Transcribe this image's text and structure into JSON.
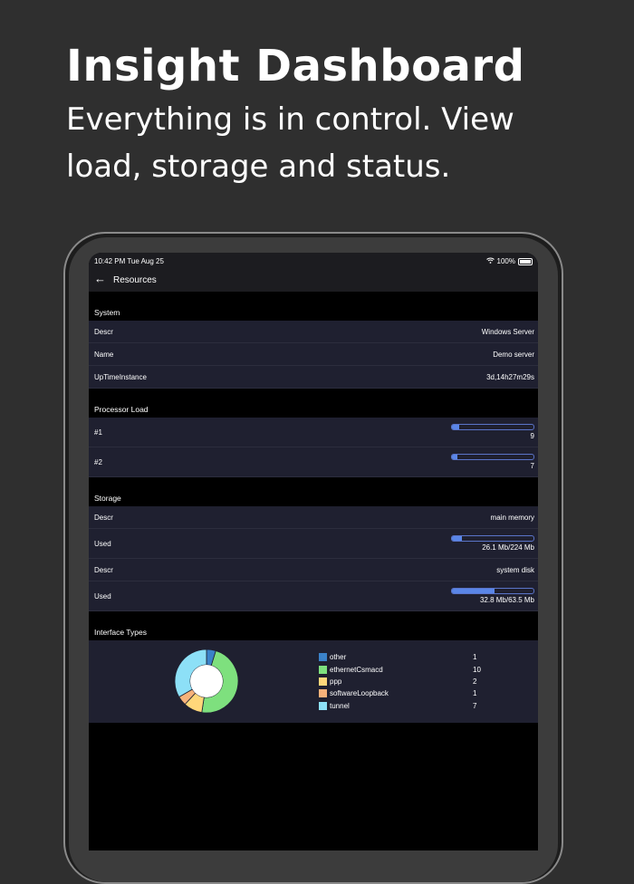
{
  "hero": {
    "title": "Insight Dashboard",
    "subtitle": "Everything is in control. View load, storage and status."
  },
  "status_bar": {
    "time": "10:42 PM   Tue Aug 25",
    "battery": "100%"
  },
  "nav": {
    "title": "Resources"
  },
  "system": {
    "header": "System",
    "rows": [
      {
        "label": "Descr",
        "value": "Windows Server"
      },
      {
        "label": "Name",
        "value": "Demo server"
      },
      {
        "label": "UpTimeInstance",
        "value": "3d,14h27m29s"
      }
    ]
  },
  "processor": {
    "header": "Processor Load",
    "rows": [
      {
        "label": "#1",
        "value": "9",
        "level": 0.09
      },
      {
        "label": "#2",
        "value": "7",
        "level": 0.07
      }
    ]
  },
  "storage": {
    "header": "Storage",
    "descr1": {
      "label": "Descr",
      "value": "main memory"
    },
    "used1": {
      "label": "Used",
      "value": "26.1 Mb/224 Mb",
      "level": 0.117
    },
    "descr2": {
      "label": "Descr",
      "value": "system disk"
    },
    "used2": {
      "label": "Used",
      "value": "32.8 Mb/63.5 Mb",
      "level": 0.517
    }
  },
  "interfaces": {
    "header": "Interface Types",
    "chart_data": {
      "type": "pie",
      "categories": [
        "other",
        "ethernetCsmacd",
        "ppp",
        "softwareLoopback",
        "tunnel"
      ],
      "values": [
        1,
        10,
        2,
        1,
        7
      ],
      "colors": [
        "#3b82c8",
        "#7ee07e",
        "#ffd77a",
        "#f7b27a",
        "#8de0f7"
      ]
    },
    "legend": [
      {
        "name": "other",
        "value": "1",
        "color": "#3b82c8"
      },
      {
        "name": "ethernetCsmacd",
        "value": "10",
        "color": "#7ee07e"
      },
      {
        "name": "ppp",
        "value": "2",
        "color": "#ffd77a"
      },
      {
        "name": "softwareLoopback",
        "value": "1",
        "color": "#f7b27a"
      },
      {
        "name": "tunnel",
        "value": "7",
        "color": "#8de0f7"
      }
    ]
  }
}
